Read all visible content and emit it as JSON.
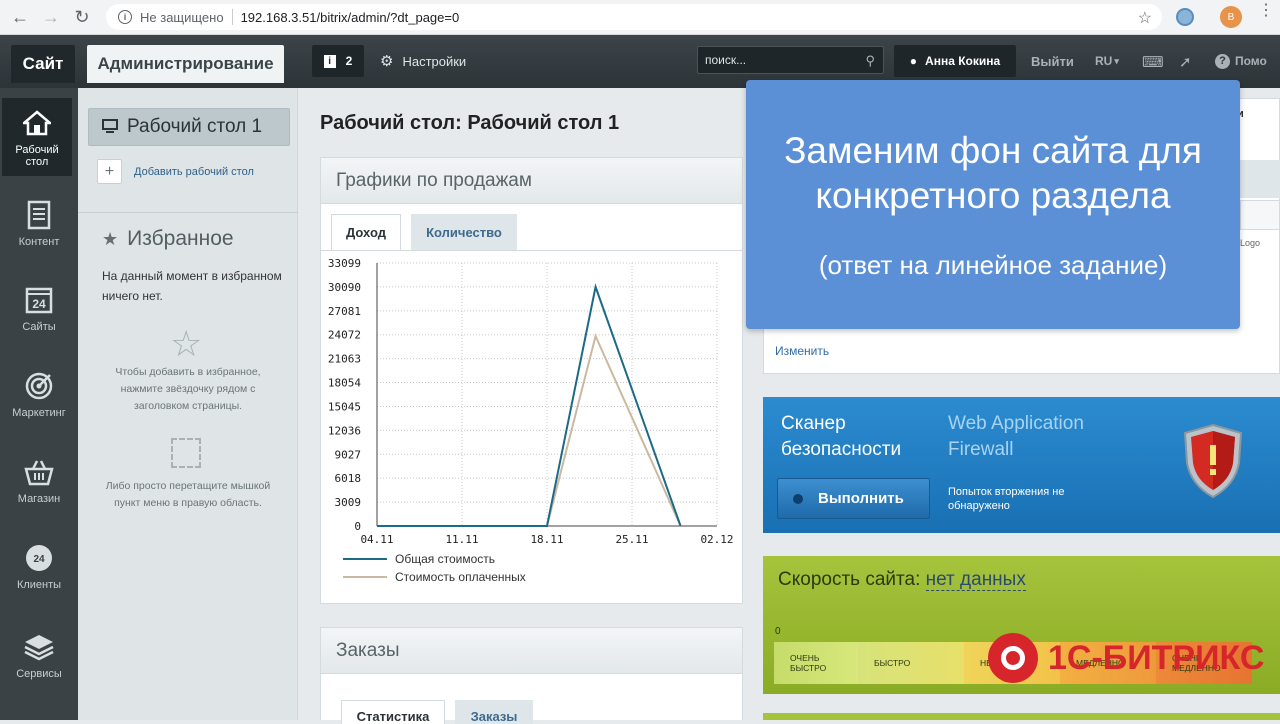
{
  "browser": {
    "security": "Не защищено",
    "url": "192.168.3.51/bitrix/admin/?dt_page=0",
    "ext_badge": "B"
  },
  "topbar": {
    "site_tab": "Сайт",
    "admin_tab": "Администрирование",
    "notifications": "2",
    "settings": "Настройки",
    "search_placeholder": "поиск...",
    "user": "Анна Кокина",
    "exit": "Выйти",
    "lang": "RU",
    "help": "Помо"
  },
  "leftnav": [
    {
      "label": "Рабочий стол",
      "icon": "home-icon"
    },
    {
      "label": "Контент",
      "icon": "document-icon"
    },
    {
      "label": "Сайты",
      "icon": "calendar-icon"
    },
    {
      "label": "Маркетинг",
      "icon": "target-icon"
    },
    {
      "label": "Магазин",
      "icon": "basket-icon"
    },
    {
      "label": "Клиенты",
      "icon": "clients-icon"
    },
    {
      "label": "Сервисы",
      "icon": "layers-icon"
    }
  ],
  "desktops": {
    "current": "Рабочий стол 1",
    "add": "Добавить рабочий стол"
  },
  "favorites": {
    "title": "Избранное",
    "empty": "На данный момент в избранном ничего нет.",
    "hint1": "Чтобы добавить в избранное, нажмите звёздочку рядом с заголовком страницы.",
    "hint2": "Либо просто перетащите мышкой пункт меню в правую область."
  },
  "page": {
    "title": "Рабочий стол: Рабочий стол 1"
  },
  "sales_card": {
    "title": "Графики по продажам",
    "tabs": [
      "Доход",
      "Количество"
    ]
  },
  "orders_card": {
    "title": "Заказы",
    "tabs": [
      "Статистика",
      "Заказы"
    ]
  },
  "chart_data": {
    "type": "line",
    "x": [
      "04.11",
      "11.11",
      "18.11",
      "25.11",
      "02.12"
    ],
    "yticks": [
      0,
      3009,
      6018,
      9027,
      12036,
      15045,
      18054,
      21063,
      24072,
      27081,
      30090,
      33099
    ],
    "ylim": [
      0,
      33099
    ],
    "grid": true,
    "legend_position": "bottom-left",
    "series": [
      {
        "name": "Общая стоимость",
        "color": "#1c6a86",
        "points": [
          [
            "04.11",
            0
          ],
          [
            "18.11",
            0
          ],
          [
            "22.11",
            30090
          ],
          [
            "29.11",
            0
          ]
        ]
      },
      {
        "name": "Стоимость оплаченных",
        "color": "#c9b9a0",
        "points": [
          [
            "04.11",
            0
          ],
          [
            "18.11",
            0
          ],
          [
            "22.11",
            23900
          ],
          [
            "29.11",
            0
          ]
        ]
      }
    ]
  },
  "overlay": {
    "title": "Заменим фон сайта для конкретного раздела",
    "subtitle": "(ответ на линейное задание)"
  },
  "right_card": {
    "change": "Изменить",
    "mini": "и",
    "logo": "Logo"
  },
  "scanner": {
    "title_line1": "Сканер",
    "title_line2": "безопасности",
    "waf_line1": "Web Application",
    "waf_line2": "Firewall",
    "button": "Выполнить",
    "status": "Попыток вторжения не обнаружено"
  },
  "speed": {
    "label": "Скорость сайта:",
    "value": "нет данных",
    "zero": "0",
    "segments": [
      "ОЧЕНЬ БЫСТРО",
      "БЫСТРО",
      "НЕПЛОХО",
      "МЕДЛЕННО",
      "ОЧЕНЬ МЕДЛЕННО"
    ]
  },
  "watermark": {
    "text": "1С-БИТРИКС"
  }
}
